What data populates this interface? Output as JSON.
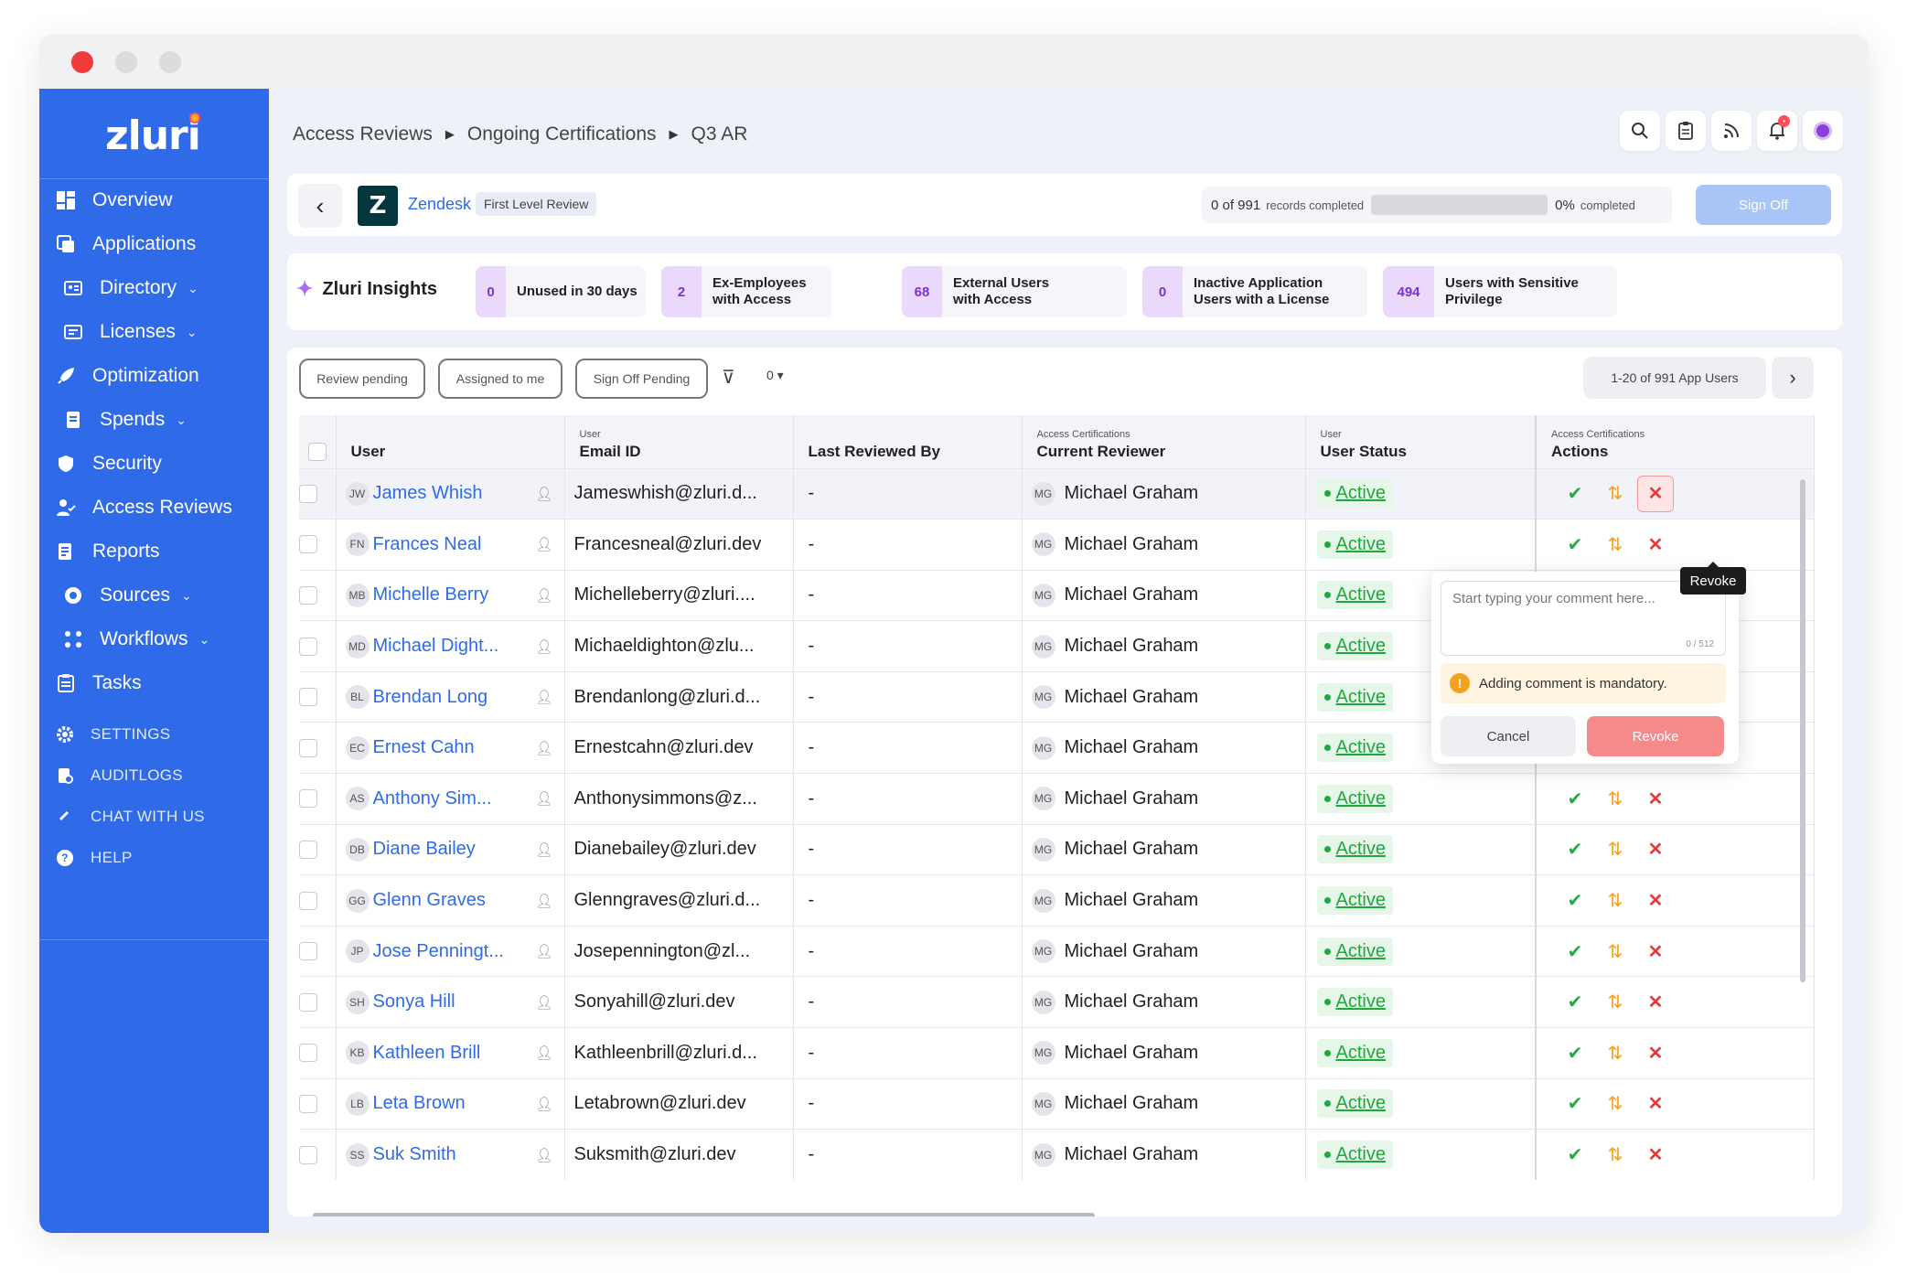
{
  "app": {
    "brand": "zluri",
    "accent": "#2f6be8"
  },
  "sidebar": {
    "items": [
      {
        "label": "Overview",
        "icon": "dashboard-icon"
      },
      {
        "label": "Applications",
        "icon": "applications-icon"
      },
      {
        "label": "Directory",
        "icon": "directory-icon",
        "chevron": "⌄"
      },
      {
        "label": "Licenses",
        "icon": "licenses-icon",
        "chevron": "⌄"
      },
      {
        "label": "Optimization",
        "icon": "rocket-icon"
      },
      {
        "label": "Spends",
        "icon": "spends-icon",
        "chevron": "⌄"
      },
      {
        "label": "Security",
        "icon": "shield-icon"
      },
      {
        "label": "Access Reviews",
        "icon": "access-reviews-icon"
      },
      {
        "label": "Reports",
        "icon": "reports-icon"
      },
      {
        "label": "Sources",
        "icon": "sources-icon",
        "chevron": "⌄"
      },
      {
        "label": "Workflows",
        "icon": "workflows-icon",
        "chevron": "⌄"
      },
      {
        "label": "Tasks",
        "icon": "tasks-icon"
      }
    ],
    "bottom": [
      {
        "label": "SETTINGS",
        "icon": "gear-icon"
      },
      {
        "label": "AUDITLOGS",
        "icon": "auditlog-icon"
      },
      {
        "label": "CHAT WITH US",
        "icon": "chat-icon"
      },
      {
        "label": "HELP",
        "icon": "help-icon"
      }
    ]
  },
  "breadcrumb": [
    "Access Reviews",
    "Ongoing Certifications",
    "Q3 AR"
  ],
  "header": {
    "app_logo": "Z",
    "app_name": "Zendesk",
    "level": "First Level Review",
    "records": "0 of 991",
    "records_label": "records completed",
    "percent": "0%",
    "percent_label": "completed",
    "progress_fraction": 0,
    "sign_off": "Sign Off"
  },
  "insights": {
    "title": "Zluri Insights",
    "cards": [
      {
        "count": "0",
        "label": "Unused in 30 days"
      },
      {
        "count": "2",
        "label": "Ex-Employees with Access"
      },
      {
        "count": "68",
        "label": "External Users with Access"
      },
      {
        "count": "0",
        "label": "Inactive Application Users with a License"
      },
      {
        "count": "494",
        "label": "Users with Sensitive Privilege"
      }
    ]
  },
  "filters": {
    "chips": [
      "Review pending",
      "Assigned to me",
      "Sign Off Pending"
    ],
    "filter_count": "0 ▾",
    "pagination": "1-20 of 991 App Users"
  },
  "table": {
    "columns": {
      "user": "User",
      "email_sup": "User",
      "email": "Email ID",
      "last": "Last Reviewed By",
      "reviewer_sup": "Access Certifications",
      "reviewer": "Current Reviewer",
      "status_sup": "User",
      "status": "User Status",
      "actions_sup": "Access Certifications",
      "actions": "Actions"
    },
    "rows": [
      {
        "initials": "JW",
        "name": "James Whish",
        "email": "Jameswhish@zluri.d...",
        "last": "-",
        "rev_initials": "MG",
        "reviewer": "Michael Graham",
        "status": "Active"
      },
      {
        "initials": "FN",
        "name": "Frances Neal",
        "email": "Francesneal@zluri.dev",
        "last": "-",
        "rev_initials": "MG",
        "reviewer": "Michael Graham",
        "status": "Active"
      },
      {
        "initials": "MB",
        "name": "Michelle Berry",
        "email": "Michelleberry@zluri....",
        "last": "-",
        "rev_initials": "MG",
        "reviewer": "Michael Graham",
        "status": "Active"
      },
      {
        "initials": "MD",
        "name": "Michael Dight...",
        "email": "Michaeldighton@zlu...",
        "last": "-",
        "rev_initials": "MG",
        "reviewer": "Michael Graham",
        "status": "Active"
      },
      {
        "initials": "BL",
        "name": "Brendan Long",
        "email": "Brendanlong@zluri.d...",
        "last": "-",
        "rev_initials": "MG",
        "reviewer": "Michael Graham",
        "status": "Active"
      },
      {
        "initials": "EC",
        "name": "Ernest Cahn",
        "email": "Ernestcahn@zluri.dev",
        "last": "-",
        "rev_initials": "MG",
        "reviewer": "Michael Graham",
        "status": "Active"
      },
      {
        "initials": "AS",
        "name": "Anthony Sim...",
        "email": "Anthonysimmons@z...",
        "last": "-",
        "rev_initials": "MG",
        "reviewer": "Michael Graham",
        "status": "Active"
      },
      {
        "initials": "DB",
        "name": "Diane Bailey",
        "email": "Dianebailey@zluri.dev",
        "last": "-",
        "rev_initials": "MG",
        "reviewer": "Michael Graham",
        "status": "Active"
      },
      {
        "initials": "GG",
        "name": "Glenn Graves",
        "email": "Glenngraves@zluri.d...",
        "last": "-",
        "rev_initials": "MG",
        "reviewer": "Michael Graham",
        "status": "Active"
      },
      {
        "initials": "JP",
        "name": "Jose Penningt...",
        "email": "Josepennington@zl...",
        "last": "-",
        "rev_initials": "MG",
        "reviewer": "Michael Graham",
        "status": "Active"
      },
      {
        "initials": "SH",
        "name": "Sonya Hill",
        "email": "Sonyahill@zluri.dev",
        "last": "-",
        "rev_initials": "MG",
        "reviewer": "Michael Graham",
        "status": "Active"
      },
      {
        "initials": "KB",
        "name": "Kathleen Brill",
        "email": "Kathleenbrill@zluri.d...",
        "last": "-",
        "rev_initials": "MG",
        "reviewer": "Michael Graham",
        "status": "Active"
      },
      {
        "initials": "LB",
        "name": "Leta Brown",
        "email": "Letabrown@zluri.dev",
        "last": "-",
        "rev_initials": "MG",
        "reviewer": "Michael Graham",
        "status": "Active"
      },
      {
        "initials": "SS",
        "name": "Suk Smith",
        "email": "Suksmith@zluri.dev",
        "last": "-",
        "rev_initials": "MG",
        "reviewer": "Michael Graham",
        "status": "Active"
      }
    ]
  },
  "popover": {
    "placeholder": "Start typing your comment here...",
    "counter": "0 / 512",
    "warning": "Adding comment is mandatory.",
    "cancel": "Cancel",
    "revoke": "Revoke"
  },
  "tooltip": "Revoke"
}
